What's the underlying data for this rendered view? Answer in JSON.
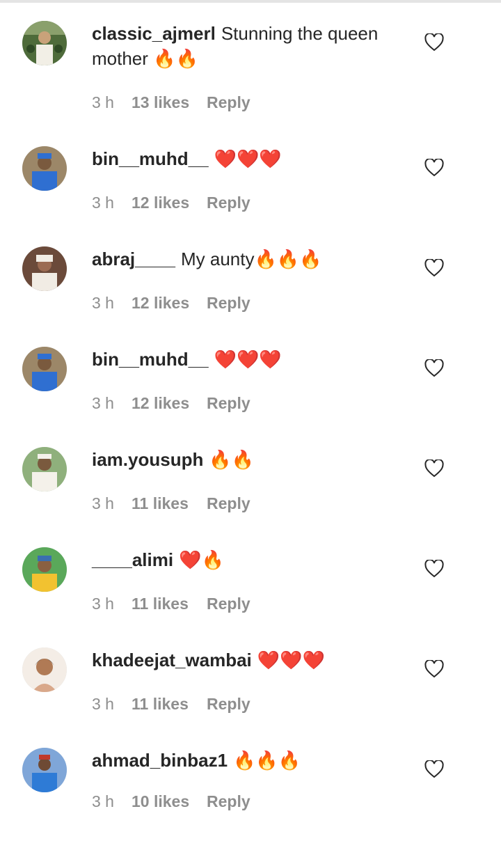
{
  "comments": [
    {
      "username": "classic_ajmerl",
      "text": "Stunning the queen mother 🔥🔥",
      "time": "3 h",
      "likes": "13 likes",
      "reply": "Reply"
    },
    {
      "username": "bin__muhd__",
      "text": "❤️❤️❤️",
      "time": "3 h",
      "likes": "12 likes",
      "reply": "Reply"
    },
    {
      "username": "abraj____",
      "text": "My aunty🔥🔥🔥",
      "time": "3 h",
      "likes": "12 likes",
      "reply": "Reply"
    },
    {
      "username": "bin__muhd__",
      "text": "❤️❤️❤️",
      "time": "3 h",
      "likes": "12 likes",
      "reply": "Reply"
    },
    {
      "username": "iam.yousuph",
      "text": "🔥🔥",
      "time": "3 h",
      "likes": "11 likes",
      "reply": "Reply"
    },
    {
      "username": "____alimi",
      "text": "❤️🔥",
      "time": "3 h",
      "likes": "11 likes",
      "reply": "Reply"
    },
    {
      "username": "khadeejat_wambai",
      "text": "❤️❤️❤️",
      "time": "3 h",
      "likes": "11 likes",
      "reply": "Reply"
    },
    {
      "username": "ahmad_binbaz1",
      "text": "🔥🔥🔥",
      "time": "3 h",
      "likes": "10 likes",
      "reply": "Reply"
    }
  ],
  "icons": {
    "like": "heart-outline-icon"
  },
  "colors": {
    "text": "#262626",
    "meta": "#8e8e8e",
    "fire": "#f57c00",
    "heart": "#e0182a"
  }
}
